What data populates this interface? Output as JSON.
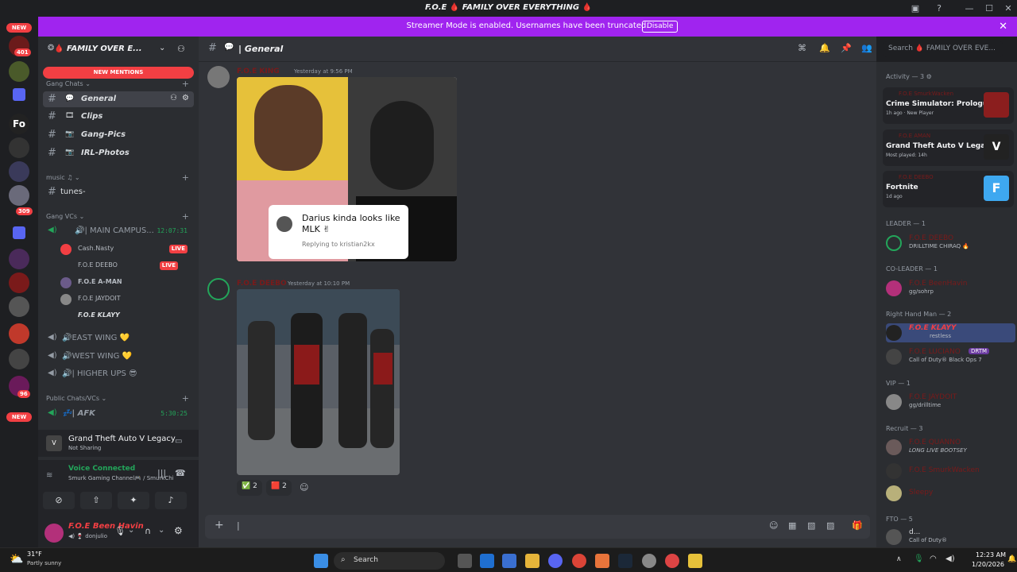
{
  "window": {
    "title": "FAMILY OVER EVERYTHING",
    "title_prefix": "F.O.E"
  },
  "banner": {
    "message": "Streamer Mode is enabled. Usernames have been truncated.",
    "disable_label": "Disable"
  },
  "rail": {
    "new_top": "NEW",
    "badge_401": "401",
    "badge_309": "309",
    "badge_96": "96",
    "new_bottom": "NEW"
  },
  "sidebar": {
    "server_name": "FAMILY OVER E...",
    "new_mentions": "NEW MENTIONS",
    "cat_gang_chats": "Gang Chats",
    "chan_general": "General",
    "chan_clips": "Clips",
    "chan_gangpics": "Gang-Pics",
    "chan_irlphotos": "IRL-Photos",
    "cat_music": "music",
    "chan_tunes": "tunes-",
    "cat_gang_vcs": "Gang VCs",
    "vc_main": "MAIN CAMPUS...",
    "vc_main_time": "12:07:31",
    "vuser_cash": "Cash.Nasty",
    "vuser_deebo": "F.O.E DEEBO",
    "vuser_aman": "F.O.E A-MAN",
    "vuser_jaydoit": "F.O.E JAYDOIT",
    "vuser_klayy": "F.O.E KLAYY",
    "live_label": "LIVE",
    "vc_east": "EAST WING",
    "vc_west": "WEST WING",
    "vc_higher": "HIGHER UPS",
    "cat_public": "Public Chats/VCs",
    "vc_afk": "AFK",
    "vc_afk_time": "5:30:25"
  },
  "activity_panel": {
    "game": "Grand Theft Auto V Legacy",
    "status": "Not Sharing"
  },
  "voice_panel": {
    "status": "Voice Connected",
    "channel": "Smurk Gaming Channel🎮 / SmurkChill..."
  },
  "user_panel": {
    "name": "F.O.E Been Havin",
    "status": "donjulio"
  },
  "main": {
    "channel_name": "General",
    "search_placeholder": "Search 🩸 FAMILY OVER EVE...",
    "msg1_author": "F.O.E KING",
    "msg1_time": "Yesterday at 9:56 PM",
    "reply_text": "Darius kinda looks like MLK ✌",
    "reply_sub": "Replying to kristian2kx",
    "msg2_author": "F.O.E DEEBO",
    "msg2_time": "Yesterday at 10:10 PM",
    "react1_count": "2",
    "react2_count": "2"
  },
  "members": {
    "activity_header": "Activity — 3",
    "act1_user": "F.O.E SmurkWacken",
    "act1_game": "Crime Simulator: Prologue",
    "act1_sub": "1h ago · New Player",
    "act2_user": "F.O.E AMAN",
    "act2_game": "Grand Theft Auto V Legacy",
    "act2_sub": "Most played: 14h",
    "act3_user": "F.O.E DEEBO",
    "act3_game": "Fortnite",
    "act3_sub": "1d ago",
    "cat_leader": "LEADER — 1",
    "m_leader_name": "F.O.E DEEBO",
    "m_leader_status": "DRILLTIME CHIRAQ 🔥",
    "cat_coleader": "CO-LEADER — 1",
    "m_coleader_name": "F.O.E BeenHavin",
    "m_coleader_status": "gg/sohrp",
    "cat_rhm": "Right Hand Man — 2",
    "m_rhm1_name": "F.O.E KLAYY",
    "m_rhm1_status": "restless",
    "m_rhm2_name": "F.O.E LUCIANO",
    "m_rhm2_tag": "DRTM",
    "m_rhm2_status": "Call of Duty® Black Ops 7",
    "cat_vip": "VIP — 1",
    "m_vip_name": "F.O.E JAYDOIT",
    "m_vip_status": "gg/drilltime",
    "cat_recruit": "Recruit — 3",
    "m_rec1_name": "F.O.E QUANNO",
    "m_rec1_status": "LONG LIVE BOOTSEY",
    "m_rec2_name": "F.O.E SmurkWacken",
    "m_rec3_name": "Sleepy",
    "cat_fto": "FTO — 5",
    "m_fto1_name": "d...",
    "m_fto1_status": "Call of Duty®"
  },
  "taskbar": {
    "weather_temp": "31°F",
    "weather_desc": "Partly sunny",
    "search_label": "Search",
    "time": "12:23 AM",
    "date": "1/20/2026"
  }
}
